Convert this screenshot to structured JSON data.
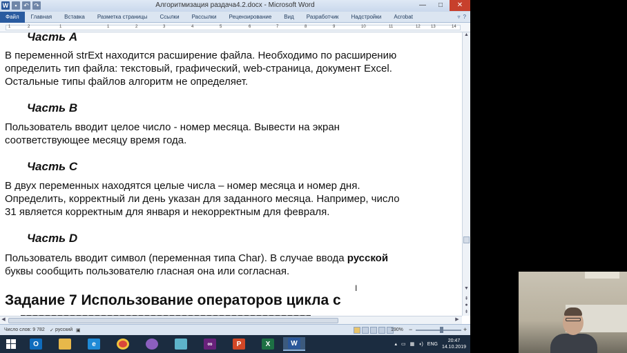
{
  "window": {
    "title": "Алгоритмизация раздача4.2.docx - Microsoft Word",
    "controls": {
      "minimize": "—",
      "maximize": "□",
      "close": "✕"
    }
  },
  "ribbon": {
    "tabs": [
      "Файл",
      "Главная",
      "Вставка",
      "Разметка страницы",
      "Ссылки",
      "Рассылки",
      "Рецензирование",
      "Вид",
      "Разработчик",
      "Надстройки",
      "Acrobat"
    ],
    "right_icons": [
      "▿",
      "?"
    ]
  },
  "ruler": {
    "numbers": [
      "1",
      "2",
      "1",
      "1",
      "2",
      "3",
      "4",
      "5",
      "6",
      "7",
      "8",
      "9",
      "10",
      "11",
      "12",
      "13",
      "14"
    ]
  },
  "document": {
    "part_a_heading": "Часть A",
    "part_a_lines": [
      "В переменной strExt находится расширение файла. Необходимо по расширению",
      "определить тип файла: текстовый, графический, web-страница, документ Excel.",
      "Остальные типы файлов алгоритм не определяет."
    ],
    "part_b_heading": "Часть B",
    "part_b_lines": [
      "Пользователь вводит целое число - номер месяца. Вывести на экран",
      "соответствующее месяцу время года."
    ],
    "part_c_heading": "Часть C",
    "part_c_lines": [
      "В двух переменных находятся целые числа – номер месяца и номер дня.",
      "Определить, корректный ли день указан для заданного месяца. Например, число",
      "31 является корректным для января и некорректным для февраля."
    ],
    "part_d_heading": "Часть D",
    "part_d_line1_pre": "Пользователь вводит символ (переменная типа Char). В случае ввода ",
    "part_d_line1_bold": "русской",
    "part_d_line2": "буквы сообщить пользователю гласная она или согласная.",
    "task_heading": "Задание 7  Использование операторов цикла с"
  },
  "status_bar": {
    "word_count": "Число слов: 9 782",
    "language": "русский",
    "zoom": "190%",
    "zoom_minus": "−",
    "zoom_plus": "+"
  },
  "taskbar": {
    "apps": [
      {
        "name": "outlook",
        "label": "O",
        "color": "#0f6cbd"
      },
      {
        "name": "explorer",
        "label": "",
        "color": "#e8b84a"
      },
      {
        "name": "ie",
        "label": "e",
        "color": "#1f8ad6"
      },
      {
        "name": "chrome",
        "label": "",
        "color": "#d9463b"
      },
      {
        "name": "picasa",
        "label": "",
        "color": "#8b5fbf"
      },
      {
        "name": "notepad",
        "label": "",
        "color": "#5eb3c9"
      },
      {
        "name": "visual-studio",
        "label": "",
        "color": "#68217a"
      },
      {
        "name": "powerpoint",
        "label": "P",
        "color": "#d24726"
      },
      {
        "name": "excel",
        "label": "X",
        "color": "#1d7044"
      },
      {
        "name": "word",
        "label": "W",
        "color": "#2b579a"
      }
    ],
    "lang": "ENG",
    "time": "20:47",
    "date": "14.10.2019"
  }
}
